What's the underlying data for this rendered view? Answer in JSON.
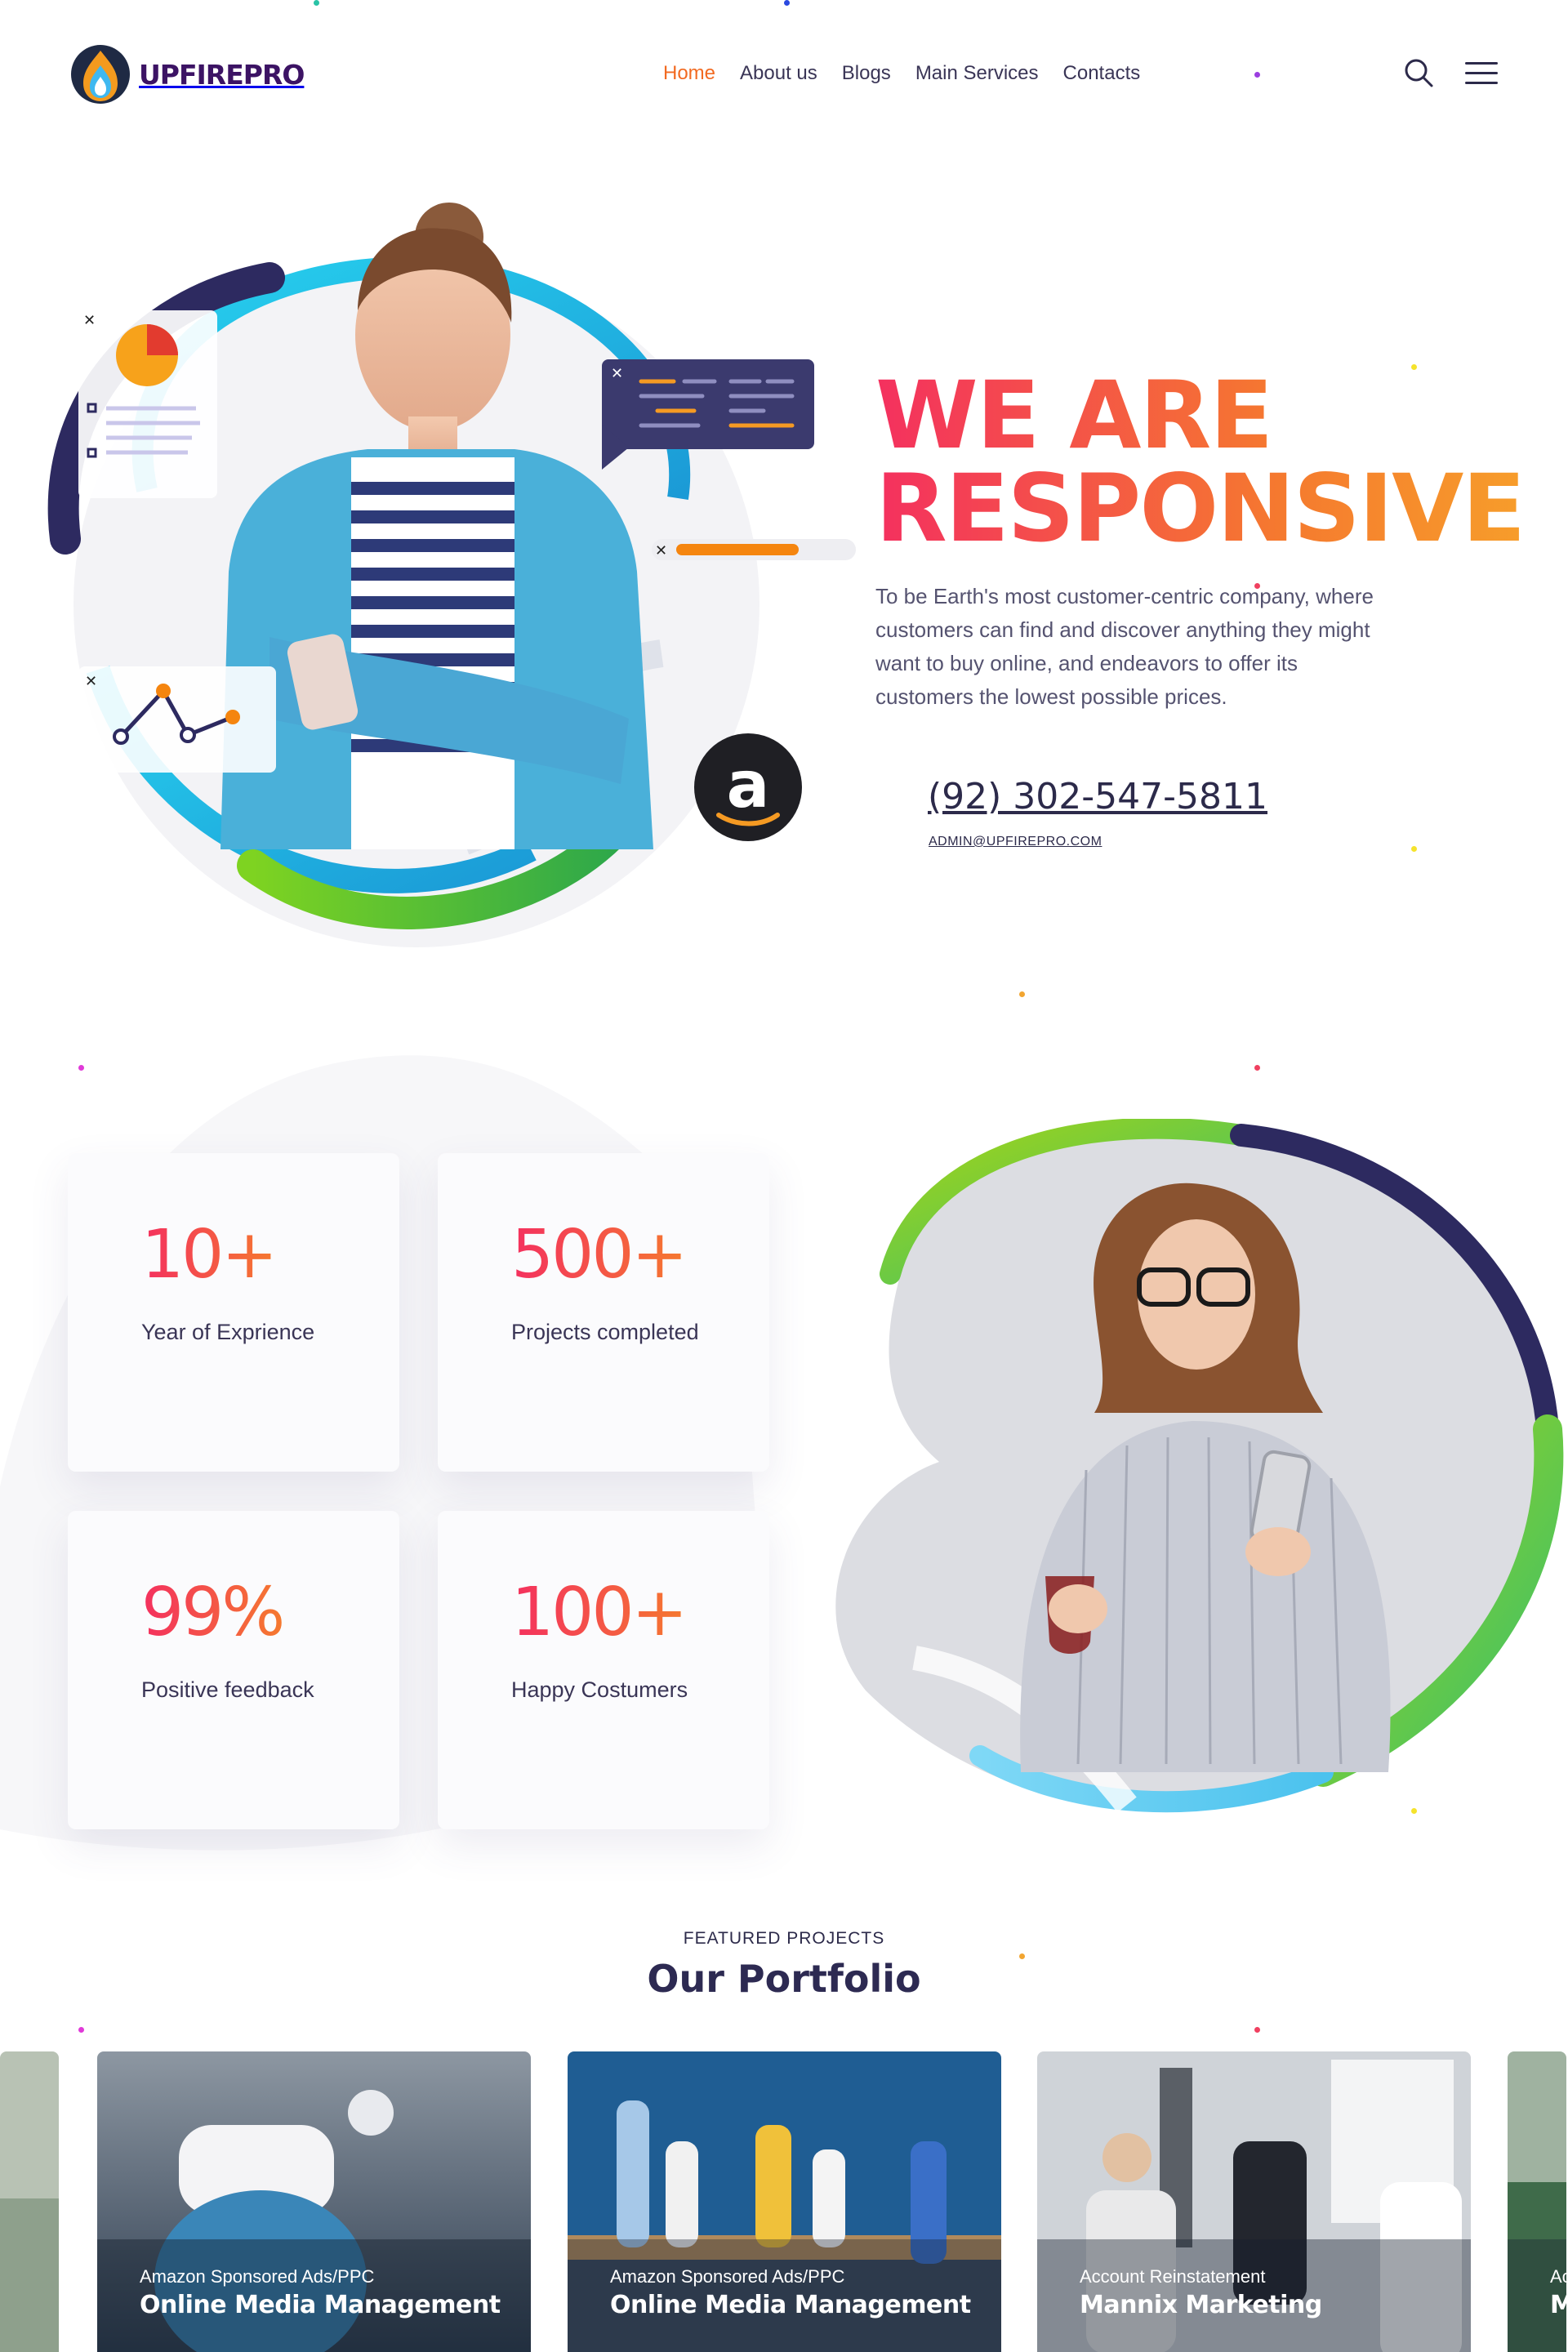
{
  "brand": {
    "name": "UPFIREPRO"
  },
  "nav": {
    "items": [
      {
        "label": "Home",
        "active": true
      },
      {
        "label": "About us",
        "active": false
      },
      {
        "label": "Blogs",
        "active": false
      },
      {
        "label": "Main Services",
        "active": false
      },
      {
        "label": "Contacts",
        "active": false
      }
    ],
    "search_icon": "search-icon",
    "menu_icon": "hamburger-menu-icon"
  },
  "hero": {
    "title_line1": "WE ARE",
    "title_line2": "RESPONSIVE",
    "description": "To be Earth's most customer-centric company, where customers can find and discover anything they might want to buy online, and endeavors to offer its customers the lowest possible prices.",
    "phone": "(92) 302-547-5811",
    "email": "ADMIN@UPFIREPRO.COM",
    "amazon_badge_letter": "a"
  },
  "stats": [
    {
      "value": "10+",
      "label": "Year of Exprience"
    },
    {
      "value": "500+",
      "label": "Projects completed"
    },
    {
      "value": "99%",
      "label": "Positive feedback"
    },
    {
      "value": "100+",
      "label": "Happy Costumers"
    }
  ],
  "portfolio": {
    "kicker": "FEATURED PROJECTS",
    "title": "Our Portfolio",
    "items": [
      {
        "category": "Amazon Sponsored Ads/PPC",
        "name": "Online Media Management"
      },
      {
        "category": "Amazon Sponsored Ads/PPC",
        "name": "Online Media Management"
      },
      {
        "category": "Account Reinstatement",
        "name": "Mannix Marketing"
      }
    ],
    "partial_next": {
      "category": "Ac",
      "name": "M"
    }
  },
  "colors": {
    "accent_orange": "#f26a21",
    "gradient_pink": "#f4305f",
    "gradient_orange": "#f7a02a",
    "navy": "#2d2a52",
    "brand_purple": "#3c1364"
  }
}
